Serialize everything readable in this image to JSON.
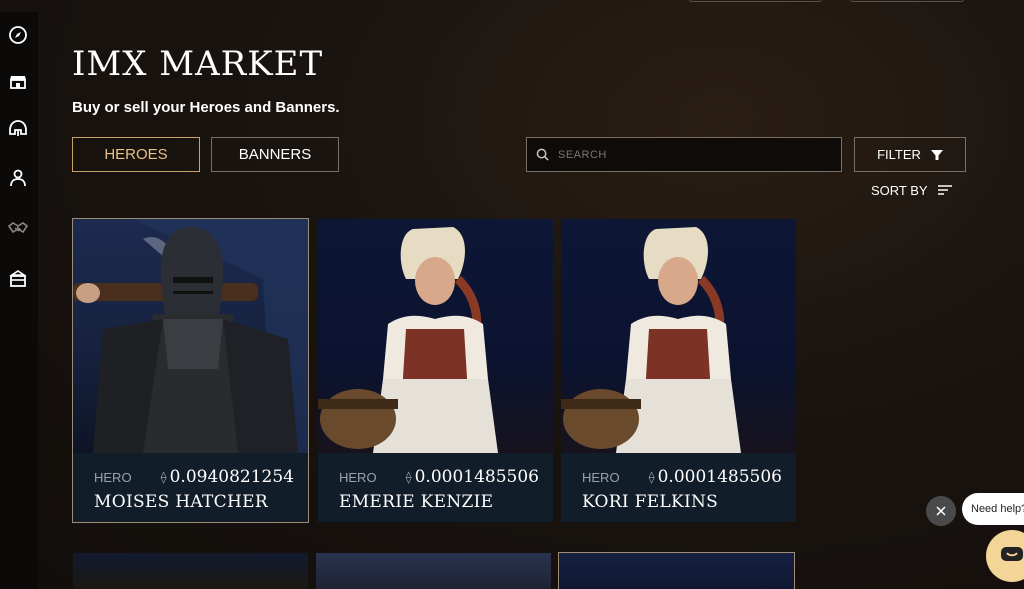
{
  "page": {
    "title": "IMX MARKET",
    "subtitle": "Buy or sell your Heroes and Banners."
  },
  "sidebar": {
    "items": [
      {
        "icon": "compass-icon",
        "label": "Explore"
      },
      {
        "icon": "store-icon",
        "label": "Market"
      },
      {
        "icon": "helmet-icon",
        "label": "Heroes"
      },
      {
        "icon": "user-icon",
        "label": "Profile"
      },
      {
        "icon": "handshake-icon",
        "label": "Trade"
      },
      {
        "icon": "gift-icon",
        "label": "Rewards"
      }
    ]
  },
  "tabs": [
    {
      "label": "HEROES",
      "active": true
    },
    {
      "label": "BANNERS",
      "active": false
    }
  ],
  "search": {
    "placeholder": "SEARCH",
    "value": ""
  },
  "filter": {
    "label": "FILTER"
  },
  "sort": {
    "label": "SORT BY"
  },
  "cards": [
    {
      "type": "HERO",
      "price": "0.0940821254",
      "name": "MOISES HATCHER",
      "art": "knight"
    },
    {
      "type": "HERO",
      "price": "0.0001485506",
      "name": "EMERIE KENZIE",
      "art": "maiden"
    },
    {
      "type": "HERO",
      "price": "0.0001485506",
      "name": "KORI FELKINS",
      "art": "maiden"
    }
  ],
  "chat": {
    "help_text": "Need help?",
    "close_icon": "close-icon",
    "chat_icon": "chat-icon",
    "accent": "#f3d597"
  },
  "colors": {
    "accent_gold": "#e8c285",
    "card_bg": "#121d2a"
  }
}
